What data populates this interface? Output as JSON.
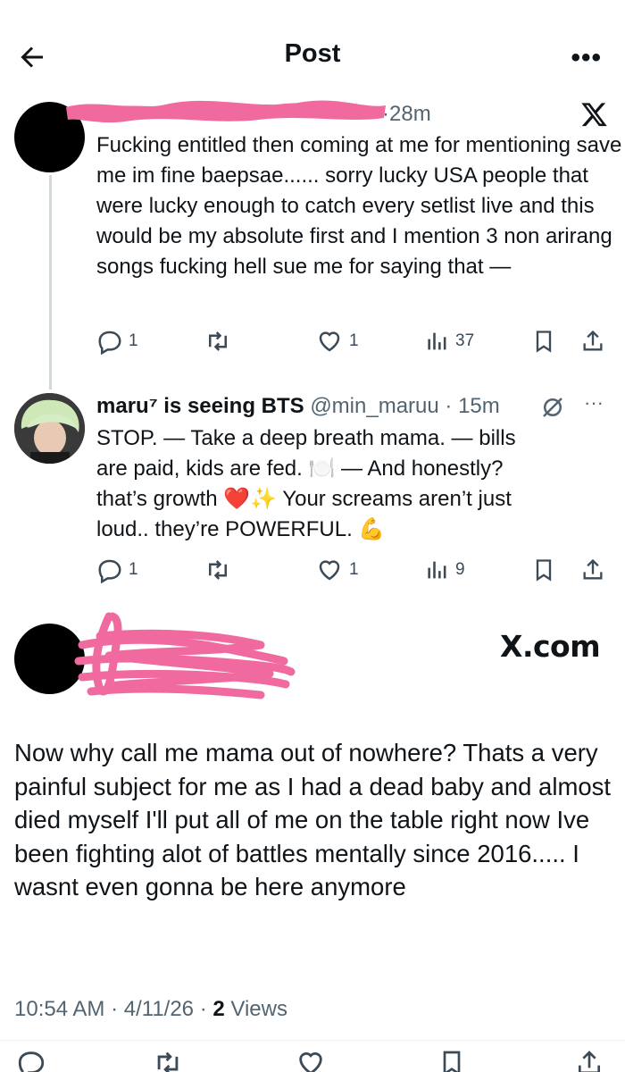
{
  "header": {
    "title": "Post",
    "back_icon": "arrow-left-icon",
    "more_label": "•••"
  },
  "reply1": {
    "time": "·28m",
    "text": "Fucking entitled then coming at me for mentioning save me im fine baepsae...... sorry lucky USA people that were lucky enough to catch every setlist live and this would be my absolute first and I mention 3 non arirang songs fucking hell sue me for saying that —",
    "replies": "1",
    "likes": "1",
    "views": "37",
    "platform_icon": "x-logo-icon"
  },
  "reply2": {
    "name": "maru⁷ is seeing BTS",
    "handle": "@min_maruu",
    "time": "· 15m",
    "line1": "STOP. — Take a deep breath mama. — bills",
    "line2": "are paid, kids are fed. 🍽️ — And honestly?",
    "line3": "that’s growth ❤️✨ Your screams aren’t just",
    "line4": "loud.. they’re POWERFUL. 💪",
    "replies": "1",
    "likes": "1",
    "views": "9"
  },
  "main_post": {
    "brand": "X.com",
    "text": "Now why call me mama out of nowhere? Thats a very painful subject for me as I had a dead baby and almost died myself I'll put all of me on the table right now Ive been fighting alot of battles mentally since 2016..... I wasnt even gonna be here anymore",
    "time": "10:54 AM · 4/11/26 · ",
    "views_count": "2",
    "views_label": " Views"
  },
  "colors": {
    "text": "#0f1419",
    "secondary": "#536471",
    "redaction": "#f06aa0",
    "thread": "#cfd9de"
  }
}
